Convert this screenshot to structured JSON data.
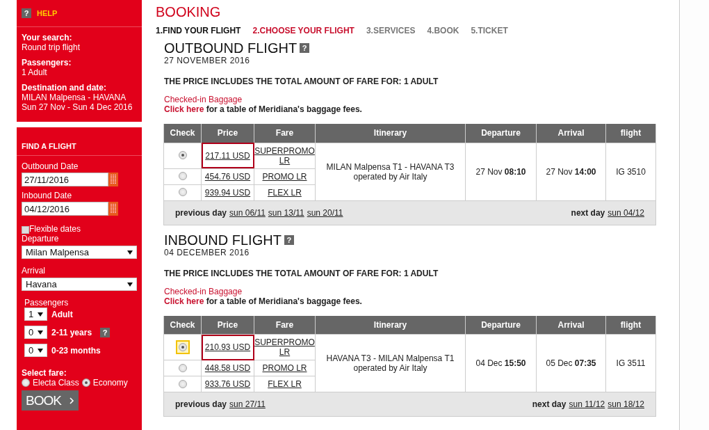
{
  "help": {
    "mark": "?",
    "title": "HELP",
    "summary": [
      {
        "label": "Your search:",
        "lines": [
          "Round trip flight"
        ]
      },
      {
        "label": "Passengers:",
        "lines": [
          "1 Adult"
        ]
      },
      {
        "label": "Destination and date:",
        "lines": [
          "MILAN Malpensa - HAVANA",
          "Sun 27 Nov - Sun 4 Dec 2016"
        ]
      }
    ]
  },
  "find_flight": {
    "title": "FIND A FLIGHT",
    "outbound_date": {
      "label": "Outbound Date",
      "value": "27/11/2016"
    },
    "inbound_date": {
      "label": "Inbound Date",
      "value": "04/12/2016"
    },
    "flexible": {
      "label": "Flexible dates",
      "checked": false
    },
    "departure": {
      "label": "Departure",
      "value": "Milan Malpensa"
    },
    "arrival": {
      "label": "Arrival",
      "value": "Havana"
    },
    "passengers": {
      "label": "Passengers",
      "rows": [
        {
          "value": "1",
          "label": "Adult"
        },
        {
          "value": "0",
          "label": "2-11 years",
          "help_mark": "?"
        },
        {
          "value": "0",
          "label": "0-23 months"
        }
      ]
    },
    "fare": {
      "label": "Select fare:",
      "options": [
        {
          "label": "Electa Class",
          "selected": false
        },
        {
          "label": "Economy",
          "selected": true
        }
      ]
    },
    "book_button": "BOOK"
  },
  "booking": {
    "title": "BOOKING",
    "steps": [
      {
        "label": "1.FIND YOUR FLIGHT",
        "selected": false
      },
      {
        "label": "2.CHOOSE YOUR FLIGHT",
        "selected": true
      },
      {
        "label": "3.SERVICES",
        "selected": false
      },
      {
        "label": "4.BOOK",
        "selected": false
      },
      {
        "label": "5.TICKET",
        "selected": false
      }
    ]
  },
  "flights": [
    {
      "title": "OUTBOUND FLIGHT",
      "help_mark": "?",
      "date": "27 NOVEMBER 2016",
      "price_note": "THE PRICE INCLUDES THE TOTAL AMOUNT OF FARE FOR: 1 ADULT",
      "baggage_title": "Checked-in Baggage",
      "baggage_link": "Click here",
      "baggage_text": "for a table of Meridiana's baggage fees.",
      "columns": [
        "Check",
        "Price",
        "Fare",
        "Itinerary",
        "Departure",
        "Arrival",
        "flight"
      ],
      "fares": [
        {
          "price": "217.11 USD",
          "fare": "SUPERPROMO LR",
          "selected": true,
          "focused": false
        },
        {
          "price": "454.76 USD",
          "fare": "PROMO LR",
          "selected": false,
          "focused": false
        },
        {
          "price": "939.94 USD",
          "fare": "FLEX LR",
          "selected": false,
          "focused": false
        }
      ],
      "itinerary": "MILAN Malpensa T1 - HAVANA T3",
      "operator": "operated by Air Italy",
      "departure": {
        "date": "27 Nov",
        "time": "08:10"
      },
      "arrival": {
        "date": "27 Nov",
        "time": "14:00"
      },
      "flight": "IG 3510",
      "previous_label": "previous day",
      "previous_days": [
        "sun 06/11",
        "sun 13/11",
        "sun 20/11"
      ],
      "next_label": "next day",
      "next_days": [
        "sun 04/12"
      ]
    },
    {
      "title": "INBOUND FLIGHT",
      "help_mark": "?",
      "date": "04 DECEMBER 2016",
      "price_note": "THE PRICE INCLUDES THE TOTAL AMOUNT OF FARE FOR: 1 ADULT",
      "baggage_title": "Checked-in Baggage",
      "baggage_link": "Click here",
      "baggage_text": "for a table of Meridiana's baggage fees.",
      "columns": [
        "Check",
        "Price",
        "Fare",
        "Itinerary",
        "Departure",
        "Arrival",
        "flight"
      ],
      "fares": [
        {
          "price": "210.93 USD",
          "fare": "SUPERPROMO LR",
          "selected": true,
          "focused": true
        },
        {
          "price": "448.58 USD",
          "fare": "PROMO LR",
          "selected": false,
          "focused": false
        },
        {
          "price": "933.76 USD",
          "fare": "FLEX LR",
          "selected": false,
          "focused": false
        }
      ],
      "itinerary": "HAVANA T3 - MILAN Malpensa T1",
      "operator": "operated by Air Italy",
      "departure": {
        "date": "04 Dec",
        "time": "15:50"
      },
      "arrival": {
        "date": "05 Dec",
        "time": "07:35"
      },
      "flight": "IG 3511",
      "previous_label": "previous day",
      "previous_days": [
        "sun 27/11"
      ],
      "next_label": "next day",
      "next_days": [
        "sun 11/12",
        "sun 18/12"
      ]
    }
  ]
}
